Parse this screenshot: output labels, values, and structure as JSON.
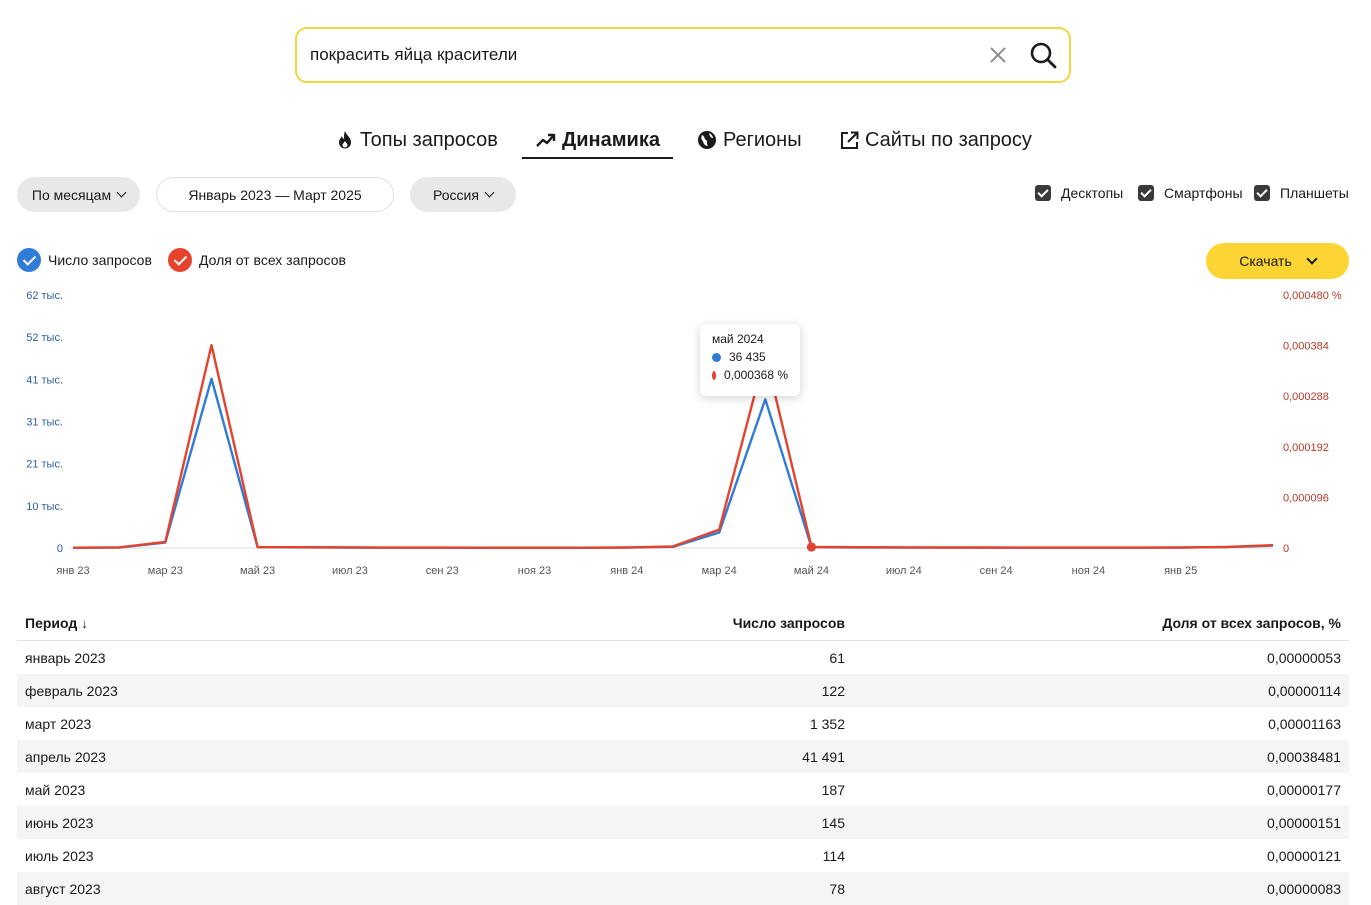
{
  "search": {
    "value": "покрасить яйца красители"
  },
  "tabs": [
    {
      "label": "Топы запросов",
      "active": false
    },
    {
      "label": "Динамика",
      "active": true
    },
    {
      "label": "Регионы",
      "active": false
    },
    {
      "label": "Сайты по запросу",
      "active": false
    }
  ],
  "filters": {
    "period_group": "По месяцам",
    "date_range": "Январь 2023 — Март 2025",
    "region": "Россия",
    "devices": [
      {
        "label": "Десктопы",
        "checked": true
      },
      {
        "label": "Смартфоны",
        "checked": true
      },
      {
        "label": "Планшеты",
        "checked": true
      }
    ]
  },
  "legend": {
    "count": "Число запросов",
    "share": "Доля от всех запросов"
  },
  "download_label": "Скачать",
  "colors": {
    "count": "#2f7bd8",
    "share": "#e5432c",
    "accent": "#fcd535",
    "search_border": "#f2d541"
  },
  "tooltip": {
    "title": "май 2024",
    "count": "36 435",
    "share": "0,000368 %"
  },
  "chart_data": {
    "type": "line",
    "x": [
      "янв 23",
      "фев 23",
      "мар 23",
      "апр 23",
      "май 23",
      "июн 23",
      "июл 23",
      "авг 23",
      "сен 23",
      "окт 23",
      "ноя 23",
      "дек 23",
      "янв 24",
      "фев 24",
      "мар 24",
      "апр 24",
      "май 24",
      "июн 24",
      "июл 24",
      "авг 24",
      "сен 24",
      "окт 24",
      "ноя 24",
      "дек 24",
      "янв 25",
      "фев 25",
      "мар 25"
    ],
    "x_tick_labels": [
      "янв 23",
      "мар 23",
      "май 23",
      "июл 23",
      "сен 23",
      "ноя 23",
      "янв 24",
      "мар 24",
      "май 24",
      "июл 24",
      "сен 24",
      "ноя 24",
      "янв 25"
    ],
    "series": [
      {
        "name": "Число запросов",
        "axis": "left",
        "values": [
          61,
          122,
          1352,
          41491,
          187,
          145,
          114,
          78,
          70,
          60,
          55,
          60,
          90,
          300,
          3800,
          36435,
          200,
          120,
          100,
          90,
          80,
          75,
          70,
          75,
          110,
          220,
          600
        ]
      },
      {
        "name": "Доля от всех запросов",
        "axis": "right",
        "values": [
          5.3e-07,
          1.14e-06,
          1.163e-05,
          0.00038481,
          1.77e-06,
          1.51e-06,
          1.21e-06,
          8.3e-07,
          7e-07,
          6e-07,
          5e-07,
          6e-07,
          9e-07,
          3e-06,
          3.5e-05,
          0.000368,
          2e-06,
          1.5e-06,
          1.2e-06,
          1e-06,
          9e-07,
          8e-07,
          8e-07,
          8e-07,
          1e-06,
          2e-06,
          5.5e-06
        ]
      }
    ],
    "y_left_ticks": [
      "0",
      "10 тыс.",
      "21 тыс.",
      "31 тыс.",
      "41 тыс.",
      "52 тыс.",
      "62 тыс."
    ],
    "y_left_lim": [
      0,
      62000
    ],
    "y_right_ticks": [
      "0",
      "0,000096",
      "0,000192",
      "0,000288",
      "0,000384",
      "0,000480 %"
    ],
    "y_right_lim": [
      0,
      0.00048
    ],
    "highlight": "май 24"
  },
  "table": {
    "headers": {
      "period": "Период",
      "sort_arrow": "↓",
      "count": "Число запросов",
      "share": "Доля от всех запросов, %"
    },
    "rows": [
      {
        "period": "январь 2023",
        "count": "61",
        "share": "0,00000053"
      },
      {
        "period": "февраль 2023",
        "count": "122",
        "share": "0,00000114"
      },
      {
        "period": "март 2023",
        "count": "1 352",
        "share": "0,00001163"
      },
      {
        "period": "апрель 2023",
        "count": "41 491",
        "share": "0,00038481"
      },
      {
        "period": "май 2023",
        "count": "187",
        "share": "0,00000177"
      },
      {
        "period": "июнь 2023",
        "count": "145",
        "share": "0,00000151"
      },
      {
        "period": "июль 2023",
        "count": "114",
        "share": "0,00000121"
      },
      {
        "period": "август 2023",
        "count": "78",
        "share": "0,00000083"
      }
    ]
  }
}
